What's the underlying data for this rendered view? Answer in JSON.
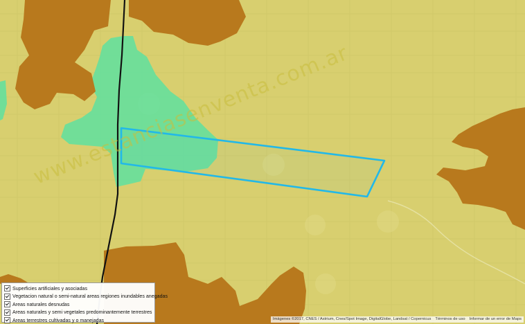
{
  "map": {
    "colors": {
      "cultivated": "#d8cf6f",
      "semi_natural": "#b8791d",
      "wetland": "#5fe0a0",
      "plot_outline": "#22b8e8",
      "road": "#111111"
    }
  },
  "watermark": {
    "text": "www.estanciasenventa.com.ar"
  },
  "legend": {
    "items": [
      {
        "label": "Superficies artificiales y asociadas",
        "checked": true
      },
      {
        "label": "Vegetacion natural o semi-natural areas regiones inundables anegadas",
        "checked": true
      },
      {
        "label": "Areas naturales desnudas",
        "checked": true
      },
      {
        "label": "Areas naturales y semi vegetales predominantemente terrestres",
        "checked": true
      },
      {
        "label": "Areas terrestres cultivadas y o manejadas",
        "checked": true
      }
    ]
  },
  "attribution": {
    "imagery": "Imágenes ©2017, CNES / Astrium, Cnes/Spot Image, DigitalGlobe, Landsat / Copernicus",
    "terms": "Términos de uso",
    "report": "Informar de un error de Maps"
  }
}
